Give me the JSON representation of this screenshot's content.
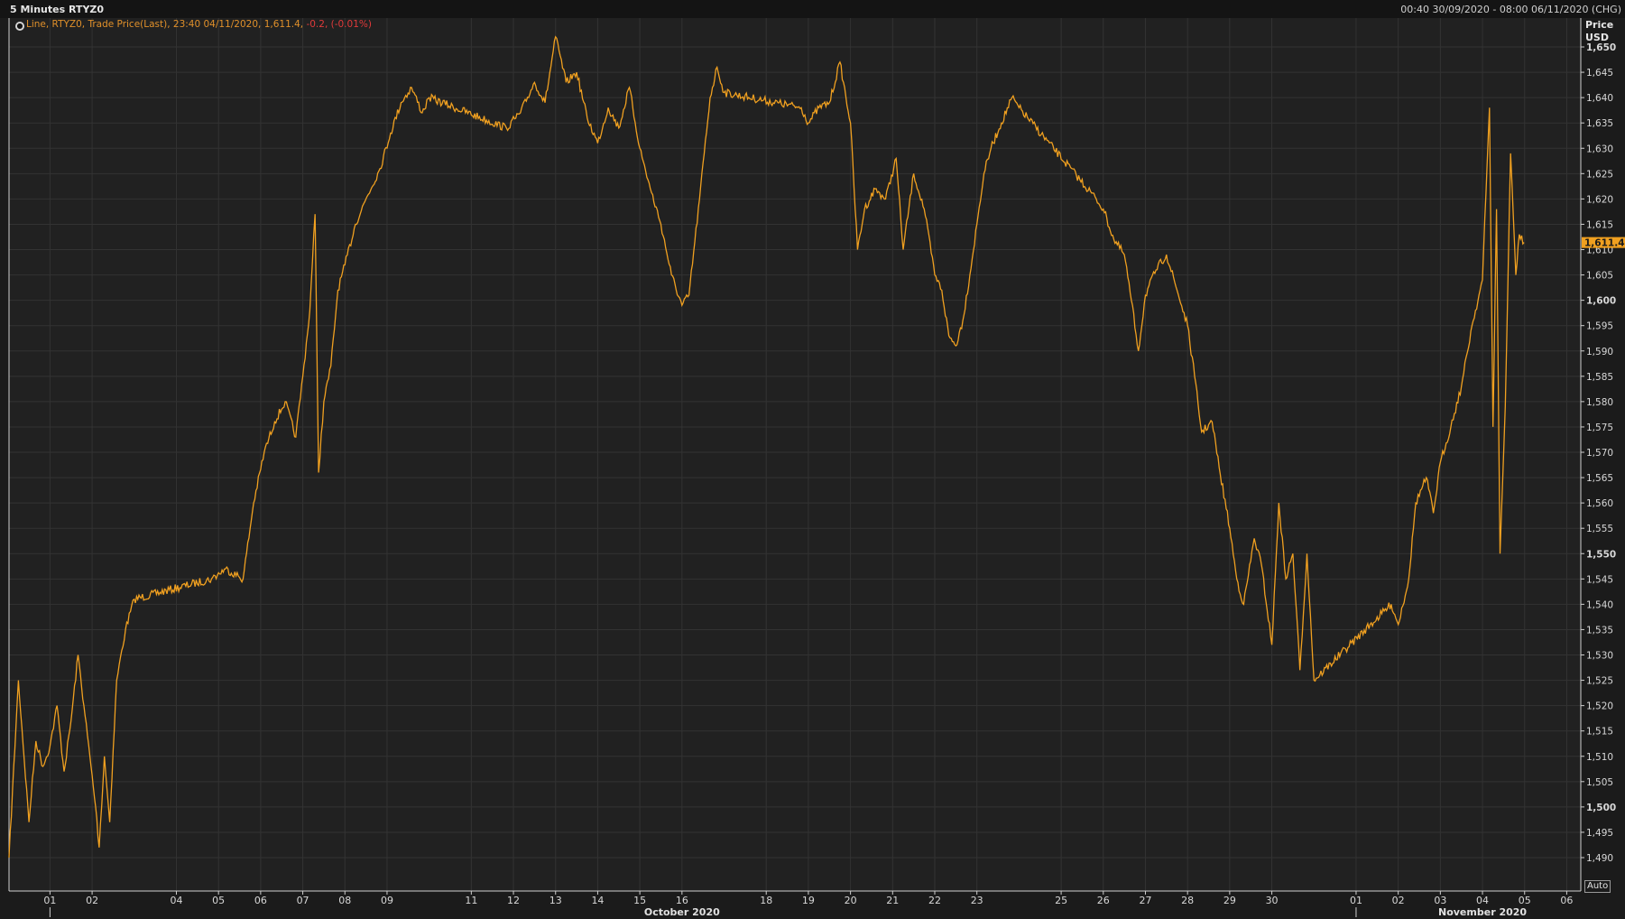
{
  "header": {
    "title": "5 Minutes RTYZ0",
    "range": "00:40 30/09/2020 - 08:00 06/11/2020 (CHG)"
  },
  "legend": {
    "prefix": "Line, RTYZ0, Trade Price(Last),  23:40 04/11/2020,  1,611.4, ",
    "change": " -0.2, (-0.01%)"
  },
  "axis": {
    "price_label": "Price",
    "unit_label": "USD",
    "auto_label": "Auto",
    "last_value_label": "1,611.4"
  },
  "colors": {
    "background": "#212121",
    "line": "#f0a020",
    "grid": "#333333",
    "negative": "#e03a3a",
    "last_value_badge": "#f0a020"
  },
  "chart_data": {
    "type": "line",
    "series": [
      {
        "name": "RTYZ0",
        "points": [
          [
            "30/09 00:40",
            1490
          ],
          [
            "30/09 06:00",
            1525
          ],
          [
            "30/09 12:00",
            1497
          ],
          [
            "30/09 16:00",
            1513
          ],
          [
            "30/09 20:00",
            1508
          ],
          [
            "01/10 00:00",
            1512
          ],
          [
            "01/10 04:00",
            1520
          ],
          [
            "01/10 08:00",
            1507
          ],
          [
            "01/10 12:00",
            1517
          ],
          [
            "01/10 16:00",
            1530
          ],
          [
            "01/10 20:00",
            1518
          ],
          [
            "02/10 02:00",
            1500
          ],
          [
            "02/10 04:00",
            1492
          ],
          [
            "02/10 07:00",
            1510
          ],
          [
            "02/10 10:00",
            1497
          ],
          [
            "02/10 14:00",
            1525
          ],
          [
            "02/10 19:00",
            1535
          ],
          [
            "03/10 00:00",
            1541
          ],
          [
            "04/10 20:00",
            1545
          ],
          [
            "05/10 04:00",
            1547
          ],
          [
            "05/10 14:00",
            1545
          ],
          [
            "05/10 20:00",
            1560
          ],
          [
            "06/10 02:00",
            1570
          ],
          [
            "06/10 08:00",
            1576
          ],
          [
            "06/10 14:00",
            1580
          ],
          [
            "06/10 20:00",
            1573
          ],
          [
            "07/10 00:00",
            1585
          ],
          [
            "07/10 04:00",
            1598
          ],
          [
            "07/10 07:00",
            1617
          ],
          [
            "07/10 09:00",
            1566
          ],
          [
            "07/10 12:00",
            1580
          ],
          [
            "07/10 16:00",
            1587
          ],
          [
            "07/10 20:00",
            1602
          ],
          [
            "08/10 00:00",
            1607
          ],
          [
            "08/10 06:00",
            1615
          ],
          [
            "08/10 12:00",
            1620
          ],
          [
            "08/10 20:00",
            1626
          ],
          [
            "09/10 02:00",
            1633
          ],
          [
            "09/10 08:00",
            1639
          ],
          [
            "09/10 14:00",
            1642
          ],
          [
            "09/10 20:00",
            1637
          ],
          [
            "10/10 00:00",
            1640
          ],
          [
            "11/10 20:00",
            1634
          ],
          [
            "12/10 04:00",
            1637
          ],
          [
            "12/10 12:00",
            1643
          ],
          [
            "12/10 18:00",
            1639
          ],
          [
            "13/10 00:00",
            1652
          ],
          [
            "13/10 06:00",
            1643
          ],
          [
            "13/10 12:00",
            1645
          ],
          [
            "13/10 18:00",
            1636
          ],
          [
            "14/10 00:00",
            1631
          ],
          [
            "14/10 06:00",
            1638
          ],
          [
            "14/10 12:00",
            1634
          ],
          [
            "14/10 18:00",
            1642
          ],
          [
            "15/10 00:00",
            1630
          ],
          [
            "15/10 06:00",
            1622
          ],
          [
            "15/10 12:00",
            1615
          ],
          [
            "15/10 18:00",
            1605
          ],
          [
            "16/10 00:00",
            1599
          ],
          [
            "16/10 04:00",
            1601
          ],
          [
            "16/10 10:00",
            1620
          ],
          [
            "16/10 16:00",
            1640
          ],
          [
            "16/10 20:00",
            1646
          ],
          [
            "17/10 00:00",
            1641
          ],
          [
            "18/10 20:00",
            1638
          ],
          [
            "19/10 00:00",
            1635
          ],
          [
            "19/10 06:00",
            1638
          ],
          [
            "19/10 12:00",
            1639
          ],
          [
            "19/10 18:00",
            1647
          ],
          [
            "20/10 00:00",
            1635
          ],
          [
            "20/10 04:00",
            1610
          ],
          [
            "20/10 08:00",
            1618
          ],
          [
            "20/10 14:00",
            1622
          ],
          [
            "20/10 20:00",
            1620
          ],
          [
            "21/10 02:00",
            1628
          ],
          [
            "21/10 06:00",
            1610
          ],
          [
            "21/10 12:00",
            1625
          ],
          [
            "21/10 18:00",
            1618
          ],
          [
            "22/10 00:00",
            1605
          ],
          [
            "22/10 04:00",
            1602
          ],
          [
            "22/10 08:00",
            1593
          ],
          [
            "22/10 12:00",
            1591
          ],
          [
            "22/10 16:00",
            1596
          ],
          [
            "22/10 20:00",
            1605
          ],
          [
            "23/10 00:00",
            1615
          ],
          [
            "23/10 04:00",
            1625
          ],
          [
            "23/10 08:00",
            1630
          ],
          [
            "23/10 14:00",
            1635
          ],
          [
            "23/10 20:00",
            1640
          ],
          [
            "24/10 00:00",
            1638
          ],
          [
            "25/10 20:00",
            1620
          ],
          [
            "26/10 00:00",
            1618
          ],
          [
            "26/10 06:00",
            1612
          ],
          [
            "26/10 12:00",
            1609
          ],
          [
            "26/10 16:00",
            1600
          ],
          [
            "26/10 20:00",
            1590
          ],
          [
            "27/10 00:00",
            1601
          ],
          [
            "27/10 06:00",
            1606
          ],
          [
            "27/10 12:00",
            1609
          ],
          [
            "27/10 18:00",
            1602
          ],
          [
            "28/10 00:00",
            1595
          ],
          [
            "28/10 04:00",
            1585
          ],
          [
            "28/10 08:00",
            1574
          ],
          [
            "28/10 14:00",
            1576
          ],
          [
            "28/10 18:00",
            1567
          ],
          [
            "29/10 00:00",
            1555
          ],
          [
            "29/10 04:00",
            1545
          ],
          [
            "29/10 08:00",
            1540
          ],
          [
            "29/10 14:00",
            1553
          ],
          [
            "29/10 18:00",
            1548
          ],
          [
            "30/10 00:00",
            1532
          ],
          [
            "30/10 04:00",
            1560
          ],
          [
            "30/10 08:00",
            1545
          ],
          [
            "30/10 12:00",
            1550
          ],
          [
            "30/10 16:00",
            1527
          ],
          [
            "30/10 20:00",
            1550
          ],
          [
            "31/10 00:00",
            1525
          ],
          [
            "01/11 20:00",
            1540
          ],
          [
            "02/11 00:00",
            1536
          ],
          [
            "02/11 06:00",
            1545
          ],
          [
            "02/11 10:00",
            1560
          ],
          [
            "02/11 16:00",
            1565
          ],
          [
            "02/11 20:00",
            1558
          ],
          [
            "03/11 00:00",
            1568
          ],
          [
            "03/11 06:00",
            1575
          ],
          [
            "03/11 12:00",
            1583
          ],
          [
            "03/11 18:00",
            1595
          ],
          [
            "04/11 00:00",
            1604
          ],
          [
            "04/11 04:00",
            1638
          ],
          [
            "04/11 06:00",
            1575
          ],
          [
            "04/11 08:00",
            1618
          ],
          [
            "04/11 10:00",
            1550
          ],
          [
            "04/11 13:00",
            1579
          ],
          [
            "04/11 16:00",
            1629
          ],
          [
            "04/11 19:00",
            1605
          ],
          [
            "04/11 21:00",
            1613
          ],
          [
            "04/11 23:40",
            1611.4
          ]
        ]
      }
    ],
    "ylim": [
      1485,
      1655
    ],
    "xlim": [
      "30/09 00:40",
      "06/11 08:00"
    ],
    "y_ticks": [
      "1,490",
      "1,495",
      "1,500",
      "1,505",
      "1,510",
      "1,515",
      "1,520",
      "1,525",
      "1,530",
      "1,535",
      "1,540",
      "1,545",
      "1,550",
      "1,555",
      "1,560",
      "1,565",
      "1,570",
      "1,575",
      "1,580",
      "1,585",
      "1,590",
      "1,595",
      "1,600",
      "1,605",
      "1,610",
      "1,615",
      "1,620",
      "1,625",
      "1,630",
      "1,635",
      "1,640",
      "1,645",
      "1,650"
    ],
    "y_ticks_bold": [
      "1,500",
      "1,550",
      "1,600",
      "1,650"
    ],
    "x_ticks": [
      {
        "label": "01",
        "t": "01/10 00:00"
      },
      {
        "label": "02",
        "t": "02/10 00:00"
      },
      {
        "label": "04",
        "t": "04/10 00:00"
      },
      {
        "label": "05",
        "t": "05/10 00:00"
      },
      {
        "label": "06",
        "t": "06/10 00:00"
      },
      {
        "label": "07",
        "t": "07/10 00:00"
      },
      {
        "label": "08",
        "t": "08/10 00:00"
      },
      {
        "label": "09",
        "t": "09/10 00:00"
      },
      {
        "label": "11",
        "t": "11/10 00:00"
      },
      {
        "label": "12",
        "t": "12/10 00:00"
      },
      {
        "label": "13",
        "t": "13/10 00:00"
      },
      {
        "label": "14",
        "t": "14/10 00:00"
      },
      {
        "label": "15",
        "t": "15/10 00:00"
      },
      {
        "label": "16",
        "t": "16/10 00:00"
      },
      {
        "label": "18",
        "t": "18/10 00:00"
      },
      {
        "label": "19",
        "t": "19/10 00:00"
      },
      {
        "label": "20",
        "t": "20/10 00:00"
      },
      {
        "label": "21",
        "t": "21/10 00:00"
      },
      {
        "label": "22",
        "t": "22/10 00:00"
      },
      {
        "label": "23",
        "t": "23/10 00:00"
      },
      {
        "label": "25",
        "t": "25/10 00:00"
      },
      {
        "label": "26",
        "t": "26/10 00:00"
      },
      {
        "label": "27",
        "t": "27/10 00:00"
      },
      {
        "label": "28",
        "t": "28/10 00:00"
      },
      {
        "label": "29",
        "t": "29/10 00:00"
      },
      {
        "label": "30",
        "t": "30/10 00:00"
      },
      {
        "label": "01",
        "t": "01/11 00:00"
      },
      {
        "label": "02",
        "t": "02/11 00:00"
      },
      {
        "label": "03",
        "t": "03/11 00:00"
      },
      {
        "label": "04",
        "t": "04/11 00:00"
      },
      {
        "label": "05",
        "t": "05/11 00:00"
      },
      {
        "label": "06",
        "t": "06/11 00:00"
      }
    ],
    "month_labels": [
      {
        "label": "October 2020",
        "t": "16/10 00:00"
      },
      {
        "label": "November 2020",
        "t": "04/11 00:00"
      }
    ],
    "grid": true,
    "legend": "top-left"
  }
}
